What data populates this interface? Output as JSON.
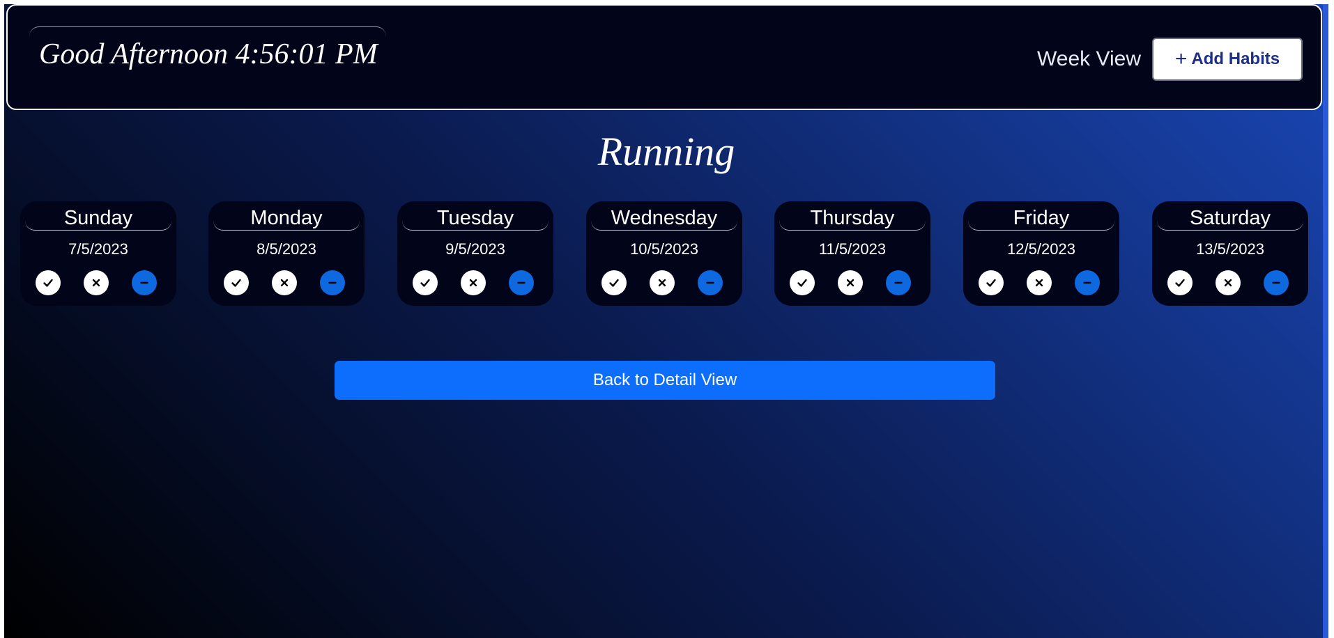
{
  "header": {
    "greeting": "Good Afternoon 4:56:01 PM",
    "view_label": "Week View",
    "add_button_label": "Add Habits",
    "add_button_icon": "plus-icon"
  },
  "habit": {
    "title": "Running"
  },
  "week": {
    "days": [
      {
        "name": "Sunday",
        "date": "7/5/2023"
      },
      {
        "name": "Monday",
        "date": "8/5/2023"
      },
      {
        "name": "Tuesday",
        "date": "9/5/2023"
      },
      {
        "name": "Wednesday",
        "date": "10/5/2023"
      },
      {
        "name": "Thursday",
        "date": "11/5/2023"
      },
      {
        "name": "Friday",
        "date": "12/5/2023"
      },
      {
        "name": "Saturday",
        "date": "13/5/2023"
      }
    ],
    "status_icons": [
      "check-icon",
      "x-icon",
      "minus-icon"
    ]
  },
  "footer": {
    "back_button_label": "Back to Detail View"
  },
  "colors": {
    "navbar_bg": "#02051a",
    "accent_blue": "#0d6efd",
    "skip_button": "#0e68e0",
    "add_button_text": "#1d2e86"
  }
}
